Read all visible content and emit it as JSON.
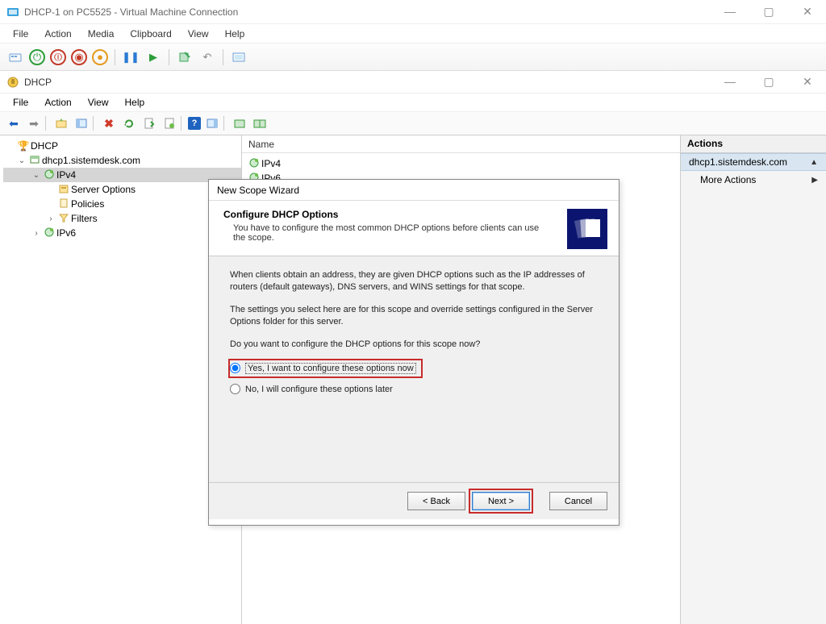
{
  "vm": {
    "title": "DHCP-1 on PC5525 - Virtual Machine Connection",
    "menus": [
      "File",
      "Action",
      "Media",
      "Clipboard",
      "View",
      "Help"
    ]
  },
  "dhcp": {
    "title": "DHCP",
    "menus": [
      "File",
      "Action",
      "View",
      "Help"
    ]
  },
  "tree": {
    "root": "DHCP",
    "server": "dhcp1.sistemdesk.com",
    "ipv4": "IPv4",
    "server_options": "Server Options",
    "policies": "Policies",
    "filters": "Filters",
    "ipv6": "IPv6"
  },
  "list": {
    "col_name": "Name",
    "items": [
      "IPv4",
      "IPv6"
    ]
  },
  "actions": {
    "header": "Actions",
    "server": "dhcp1.sistemdesk.com",
    "more": "More Actions"
  },
  "wizard": {
    "title": "New Scope Wizard",
    "heading": "Configure DHCP Options",
    "subheading": "You have to configure the most common DHCP options before clients can use the scope.",
    "p1": "When clients obtain an address, they are given DHCP options such as the IP addresses of routers (default gateways), DNS servers, and WINS settings for that scope.",
    "p2": "The settings you select here are for this scope and override settings configured in the Server Options folder for this server.",
    "p3": "Do you want to configure the DHCP options for this scope now?",
    "opt_yes": "Yes, I want to configure these options now",
    "opt_no": "No, I will configure these options later",
    "btn_back": "< Back",
    "btn_next": "Next >",
    "btn_cancel": "Cancel"
  }
}
